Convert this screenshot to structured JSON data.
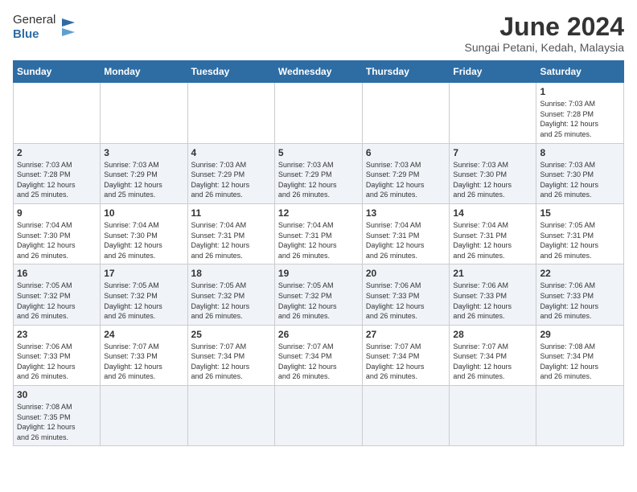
{
  "header": {
    "logo_general": "General",
    "logo_blue": "Blue",
    "title": "June 2024",
    "subtitle": "Sungai Petani, Kedah, Malaysia"
  },
  "weekdays": [
    "Sunday",
    "Monday",
    "Tuesday",
    "Wednesday",
    "Thursday",
    "Friday",
    "Saturday"
  ],
  "weeks": [
    {
      "shaded": false,
      "days": [
        {
          "number": "",
          "info": ""
        },
        {
          "number": "",
          "info": ""
        },
        {
          "number": "",
          "info": ""
        },
        {
          "number": "",
          "info": ""
        },
        {
          "number": "",
          "info": ""
        },
        {
          "number": "",
          "info": ""
        },
        {
          "number": "1",
          "info": "Sunrise: 7:03 AM\nSunset: 7:28 PM\nDaylight: 12 hours\nand 25 minutes."
        }
      ]
    },
    {
      "shaded": true,
      "days": [
        {
          "number": "2",
          "info": "Sunrise: 7:03 AM\nSunset: 7:28 PM\nDaylight: 12 hours\nand 25 minutes."
        },
        {
          "number": "3",
          "info": "Sunrise: 7:03 AM\nSunset: 7:29 PM\nDaylight: 12 hours\nand 25 minutes."
        },
        {
          "number": "4",
          "info": "Sunrise: 7:03 AM\nSunset: 7:29 PM\nDaylight: 12 hours\nand 26 minutes."
        },
        {
          "number": "5",
          "info": "Sunrise: 7:03 AM\nSunset: 7:29 PM\nDaylight: 12 hours\nand 26 minutes."
        },
        {
          "number": "6",
          "info": "Sunrise: 7:03 AM\nSunset: 7:29 PM\nDaylight: 12 hours\nand 26 minutes."
        },
        {
          "number": "7",
          "info": "Sunrise: 7:03 AM\nSunset: 7:30 PM\nDaylight: 12 hours\nand 26 minutes."
        },
        {
          "number": "8",
          "info": "Sunrise: 7:03 AM\nSunset: 7:30 PM\nDaylight: 12 hours\nand 26 minutes."
        }
      ]
    },
    {
      "shaded": false,
      "days": [
        {
          "number": "9",
          "info": "Sunrise: 7:04 AM\nSunset: 7:30 PM\nDaylight: 12 hours\nand 26 minutes."
        },
        {
          "number": "10",
          "info": "Sunrise: 7:04 AM\nSunset: 7:30 PM\nDaylight: 12 hours\nand 26 minutes."
        },
        {
          "number": "11",
          "info": "Sunrise: 7:04 AM\nSunset: 7:31 PM\nDaylight: 12 hours\nand 26 minutes."
        },
        {
          "number": "12",
          "info": "Sunrise: 7:04 AM\nSunset: 7:31 PM\nDaylight: 12 hours\nand 26 minutes."
        },
        {
          "number": "13",
          "info": "Sunrise: 7:04 AM\nSunset: 7:31 PM\nDaylight: 12 hours\nand 26 minutes."
        },
        {
          "number": "14",
          "info": "Sunrise: 7:04 AM\nSunset: 7:31 PM\nDaylight: 12 hours\nand 26 minutes."
        },
        {
          "number": "15",
          "info": "Sunrise: 7:05 AM\nSunset: 7:31 PM\nDaylight: 12 hours\nand 26 minutes."
        }
      ]
    },
    {
      "shaded": true,
      "days": [
        {
          "number": "16",
          "info": "Sunrise: 7:05 AM\nSunset: 7:32 PM\nDaylight: 12 hours\nand 26 minutes."
        },
        {
          "number": "17",
          "info": "Sunrise: 7:05 AM\nSunset: 7:32 PM\nDaylight: 12 hours\nand 26 minutes."
        },
        {
          "number": "18",
          "info": "Sunrise: 7:05 AM\nSunset: 7:32 PM\nDaylight: 12 hours\nand 26 minutes."
        },
        {
          "number": "19",
          "info": "Sunrise: 7:05 AM\nSunset: 7:32 PM\nDaylight: 12 hours\nand 26 minutes."
        },
        {
          "number": "20",
          "info": "Sunrise: 7:06 AM\nSunset: 7:33 PM\nDaylight: 12 hours\nand 26 minutes."
        },
        {
          "number": "21",
          "info": "Sunrise: 7:06 AM\nSunset: 7:33 PM\nDaylight: 12 hours\nand 26 minutes."
        },
        {
          "number": "22",
          "info": "Sunrise: 7:06 AM\nSunset: 7:33 PM\nDaylight: 12 hours\nand 26 minutes."
        }
      ]
    },
    {
      "shaded": false,
      "days": [
        {
          "number": "23",
          "info": "Sunrise: 7:06 AM\nSunset: 7:33 PM\nDaylight: 12 hours\nand 26 minutes."
        },
        {
          "number": "24",
          "info": "Sunrise: 7:07 AM\nSunset: 7:33 PM\nDaylight: 12 hours\nand 26 minutes."
        },
        {
          "number": "25",
          "info": "Sunrise: 7:07 AM\nSunset: 7:34 PM\nDaylight: 12 hours\nand 26 minutes."
        },
        {
          "number": "26",
          "info": "Sunrise: 7:07 AM\nSunset: 7:34 PM\nDaylight: 12 hours\nand 26 minutes."
        },
        {
          "number": "27",
          "info": "Sunrise: 7:07 AM\nSunset: 7:34 PM\nDaylight: 12 hours\nand 26 minutes."
        },
        {
          "number": "28",
          "info": "Sunrise: 7:07 AM\nSunset: 7:34 PM\nDaylight: 12 hours\nand 26 minutes."
        },
        {
          "number": "29",
          "info": "Sunrise: 7:08 AM\nSunset: 7:34 PM\nDaylight: 12 hours\nand 26 minutes."
        }
      ]
    },
    {
      "shaded": true,
      "days": [
        {
          "number": "30",
          "info": "Sunrise: 7:08 AM\nSunset: 7:35 PM\nDaylight: 12 hours\nand 26 minutes."
        },
        {
          "number": "",
          "info": ""
        },
        {
          "number": "",
          "info": ""
        },
        {
          "number": "",
          "info": ""
        },
        {
          "number": "",
          "info": ""
        },
        {
          "number": "",
          "info": ""
        },
        {
          "number": "",
          "info": ""
        }
      ]
    }
  ]
}
